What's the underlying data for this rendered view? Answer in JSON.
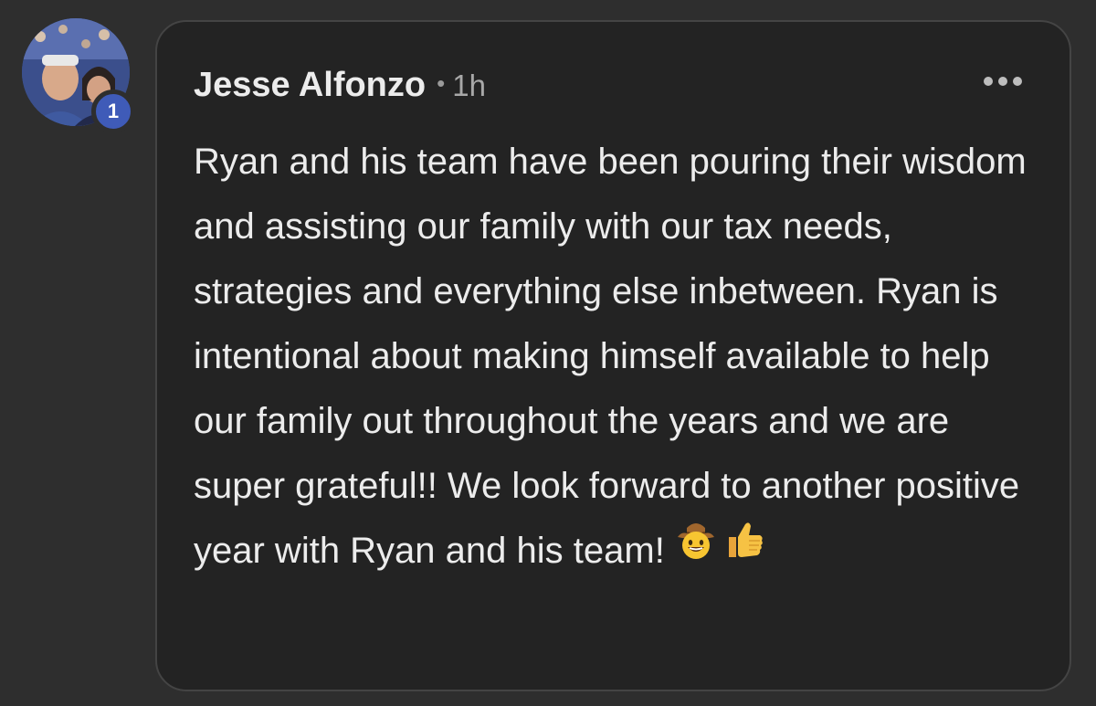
{
  "comment": {
    "author": "Jesse Alfonzo",
    "separator": "•",
    "time": "1h",
    "badge_count": "1",
    "text": "Ryan and his team have been pouring their wisdom and assisting our family with our tax needs, strategies and everything else inbetween. Ryan is intentional about making himself available to help our family out throughout the years and we are super grateful!! We look forward to another positive year with Ryan and his team!",
    "emojis": [
      "cowboy-face-emoji",
      "thumbs-up-emoji"
    ]
  },
  "icons": {
    "more_options": "more-options-icon"
  },
  "colors": {
    "background": "#2e2e2e",
    "bubble": "#232323",
    "bubble_border": "#444444",
    "text": "#ececec",
    "muted": "#a8a8a8",
    "badge": "#3f5bb8"
  }
}
